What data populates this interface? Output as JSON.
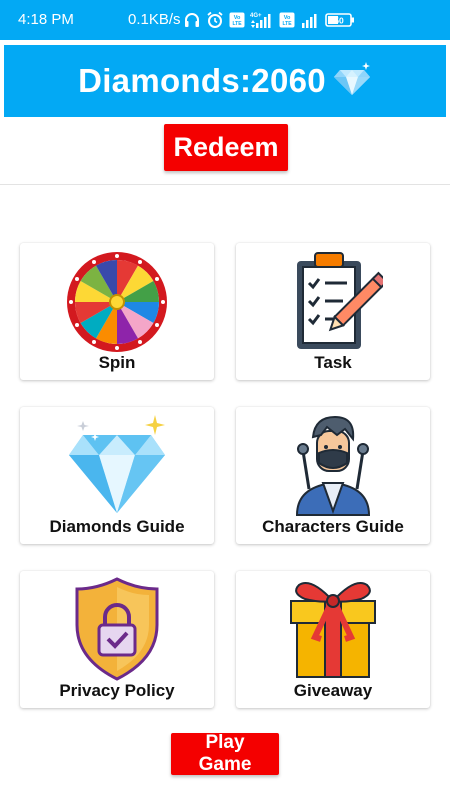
{
  "status_bar": {
    "time": "4:18 PM",
    "net_speed": "0.1KB/s",
    "icons": [
      "headphones-icon",
      "alarm-icon",
      "volte-icon",
      "signal-icon",
      "volte-icon",
      "signal-icon",
      "battery-icon"
    ],
    "network": "4G+",
    "volte": "Vo LTE",
    "battery": "50"
  },
  "header": {
    "title": "Diamonds:2060",
    "icon": "diamond-icon",
    "background": "#03a9f4"
  },
  "redeem_button": {
    "label": "Redeem",
    "color": "#f40000"
  },
  "menu": [
    {
      "label": "Spin",
      "icon": "prize-wheel-icon"
    },
    {
      "label": "Task",
      "icon": "clipboard-checklist-icon"
    },
    {
      "label": "Diamonds Guide",
      "icon": "diamond-icon"
    },
    {
      "label": "Characters Guide",
      "icon": "character-avatar-icon"
    },
    {
      "label": "Privacy Policy",
      "icon": "shield-lock-icon"
    },
    {
      "label": "Giveaway",
      "icon": "gift-box-icon"
    }
  ],
  "play_button": {
    "label": "Play Game",
    "color": "#f40000"
  }
}
